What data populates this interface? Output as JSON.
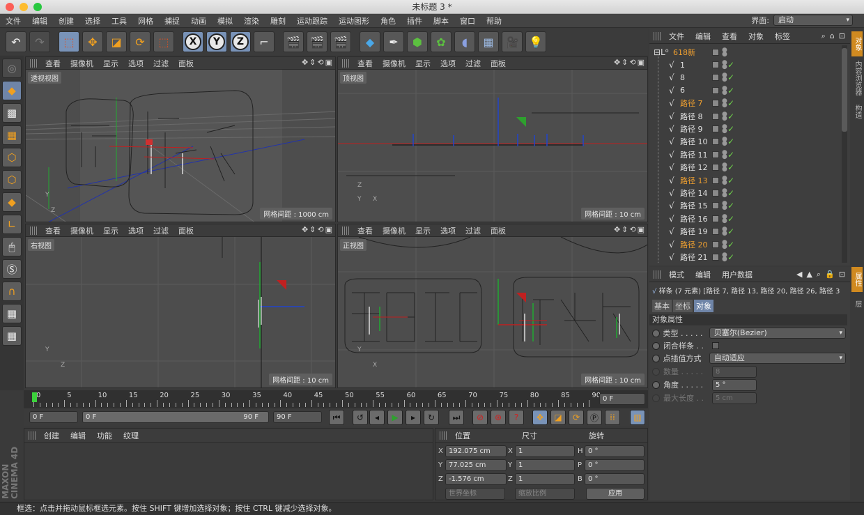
{
  "window": {
    "title": "未标题 3 *"
  },
  "menu": [
    "文件",
    "编辑",
    "创建",
    "选择",
    "工具",
    "网格",
    "捕捉",
    "动画",
    "模拟",
    "渲染",
    "雕刻",
    "运动跟踪",
    "运动图形",
    "角色",
    "插件",
    "脚本",
    "窗口",
    "帮助"
  ],
  "layout": {
    "label": "界面:",
    "value": "启动"
  },
  "viewport_menu": [
    "查看",
    "摄像机",
    "显示",
    "选项",
    "过滤",
    "面板"
  ],
  "viewports": [
    {
      "name": "透视视图",
      "grid": "网格间距 : 1000 cm"
    },
    {
      "name": "顶视图",
      "grid": "网格间距 : 10 cm"
    },
    {
      "name": "右视图",
      "grid": "网格间距 : 10 cm"
    },
    {
      "name": "正视图",
      "grid": "网格间距 : 10 cm"
    }
  ],
  "axis_labels": {
    "x": "X",
    "y": "Y",
    "z": "Z"
  },
  "timeline": {
    "ticks": [
      "0",
      "5",
      "10",
      "15",
      "20",
      "25",
      "30",
      "35",
      "40",
      "45",
      "50",
      "55",
      "60",
      "65",
      "70",
      "75",
      "80",
      "85",
      "90"
    ],
    "current": "0 F"
  },
  "transport": {
    "start": "0 F",
    "range_start": "0 F",
    "range_end": "90 F",
    "end": "90 F"
  },
  "material_menu": [
    "创建",
    "编辑",
    "功能",
    "纹理"
  ],
  "coords": {
    "headers": [
      "位置",
      "尺寸",
      "旋转"
    ],
    "rows": [
      {
        "axis": "X",
        "pos": "192.075 cm",
        "size_axis": "X",
        "size": "1",
        "rot_axis": "H",
        "rot": "0 °"
      },
      {
        "axis": "Y",
        "pos": "77.025 cm",
        "size_axis": "Y",
        "size": "1",
        "rot_axis": "P",
        "rot": "0 °"
      },
      {
        "axis": "Z",
        "pos": "-1.576 cm",
        "size_axis": "Z",
        "size": "1",
        "rot_axis": "B",
        "rot": "0 °"
      }
    ],
    "world": "世界坐标",
    "scale": "缩放比例",
    "apply": "应用"
  },
  "object_manager": {
    "menu": [
      "文件",
      "编辑",
      "查看",
      "对象",
      "标签"
    ],
    "root": "618新",
    "items": [
      {
        "name": "1",
        "highlight": false
      },
      {
        "name": "8",
        "highlight": false
      },
      {
        "name": "6",
        "highlight": false
      },
      {
        "name": "路径 7",
        "highlight": true
      },
      {
        "name": "路径 8",
        "highlight": false
      },
      {
        "name": "路径 9",
        "highlight": false
      },
      {
        "name": "路径 10",
        "highlight": false
      },
      {
        "name": "路径 11",
        "highlight": false
      },
      {
        "name": "路径 12",
        "highlight": false
      },
      {
        "name": "路径 13",
        "highlight": true
      },
      {
        "name": "路径 14",
        "highlight": false
      },
      {
        "name": "路径 15",
        "highlight": false
      },
      {
        "name": "路径 16",
        "highlight": false
      },
      {
        "name": "路径 19",
        "highlight": false
      },
      {
        "name": "路径 20",
        "highlight": true
      },
      {
        "name": "路径 21",
        "highlight": false
      }
    ]
  },
  "attributes": {
    "menu": [
      "模式",
      "编辑",
      "用户数据"
    ],
    "title": "样条 (7 元素) [路径 7, 路径 13, 路径 20, 路径 26, 路径 3",
    "tabs": [
      "基本",
      "坐标",
      "对象"
    ],
    "section": "对象属性",
    "rows": [
      {
        "label": "类型 . . . . .",
        "value": "贝塞尔(Bezier)"
      },
      {
        "label": "闭合样条 . .",
        "value": ""
      },
      {
        "label": "点插值方式",
        "value": "自动适应"
      },
      {
        "label": "数量 . . . . .",
        "value": "8"
      },
      {
        "label": "角度 . . . . .",
        "value": "5 °"
      },
      {
        "label": "最大长度 . .",
        "value": "5 cm"
      }
    ]
  },
  "right_tabs": [
    "对象",
    "内容浏览器",
    "构造"
  ],
  "right_tabs2": [
    "属性",
    "层"
  ],
  "branding": "MAXON CINEMA 4D",
  "status": "框选：点击并拖动鼠标框选元素。按住 SHIFT 键增加选择对象；按住 CTRL 键减少选择对象。"
}
